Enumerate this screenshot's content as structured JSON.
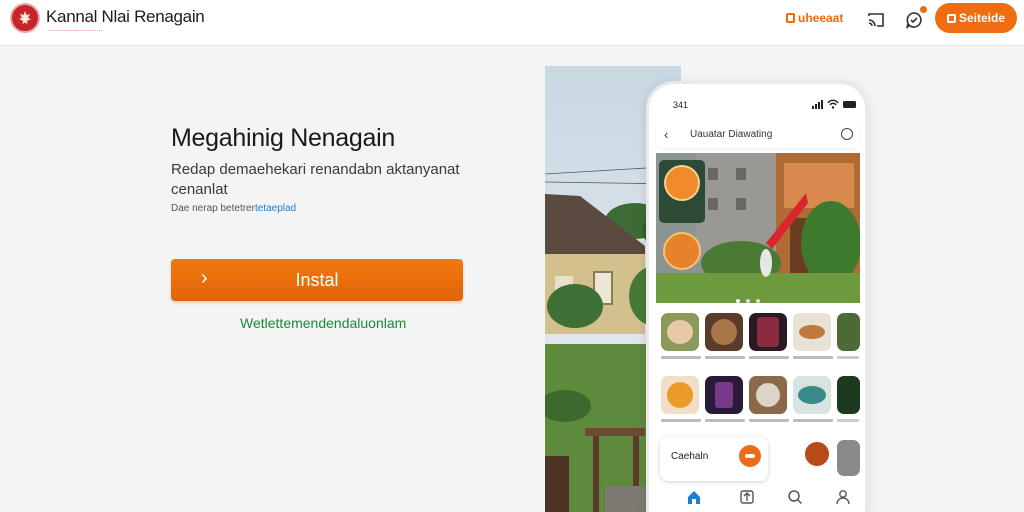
{
  "header": {
    "brand_name": "Kannal Nlai Renagain",
    "brand_tagline": "............................",
    "link_label": "uheeaat",
    "button_label": "Seiteide",
    "accent_color": "#ef6c10",
    "icons": [
      "logo-emblem",
      "cast-icon",
      "chat-icon",
      "notification-dot"
    ]
  },
  "hero": {
    "title": "Megahinig Nenagain",
    "subtitle": "Redap demaehekari renandabn aktanyanat cenanlat",
    "note_text": "Dae nerap betetrer",
    "note_link": "tetaeplad",
    "install_label": "Instal",
    "install_arrow": "›",
    "secondary_link": "Wetlettemendendaluonlam"
  },
  "phone": {
    "status_time": "341",
    "app_title": "Uauatar Diawating",
    "chip_label": "Caehaln",
    "nav_icons": [
      "home-icon",
      "gift-icon",
      "search-icon",
      "profile-icon"
    ]
  }
}
